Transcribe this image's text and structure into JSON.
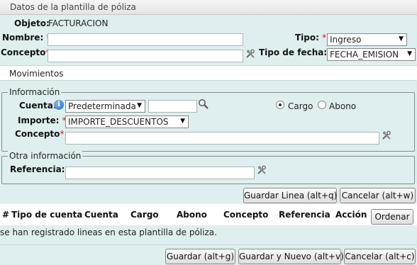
{
  "window": {
    "title": "Datos de la plantilla de póliza"
  },
  "header": {
    "objeto_label": "Objeto:",
    "objeto_value": "FACTURACION",
    "nombre_label": "Nombre:",
    "nombre_value": "",
    "concepto_label": "Concepto",
    "concepto_value": "",
    "tipo_label": "Tipo:",
    "tipo_value": "Ingreso",
    "tipo_fecha_label": "Tipo de fecha:",
    "tipo_fecha_value": "FECHA_EMISION",
    "required_mark": "*"
  },
  "tabs": {
    "movimientos": "Movimientos"
  },
  "informacion": {
    "legend": "Información",
    "cuenta_label": "Cuenta:",
    "cuenta_select": "Predeterminada",
    "cuenta_value": "",
    "cargo_label": "Cargo",
    "abono_label": "Abono",
    "cargo_selected": true,
    "importe_label": "Importe:",
    "importe_value": "IMPORTE_DESCUENTOS",
    "concepto_label": "Concepto",
    "concepto_value": ""
  },
  "otra_informacion": {
    "legend": "Otra información",
    "referencia_label": "Referencia:",
    "referencia_value": ""
  },
  "line_actions": {
    "save_line": "Guardar Linea (alt+q)",
    "cancel_line": "Cancelar (alt+w)"
  },
  "table": {
    "columns": [
      "#",
      "Tipo de cuenta",
      "Cuenta",
      "Cargo",
      "Abono",
      "Concepto",
      "Referencia",
      "Acción"
    ],
    "sort_button": "Ordenar",
    "empty_message": "se han registrado lineas en esta plantilla de póliza."
  },
  "footer": {
    "save": "Guardar (alt+g)",
    "save_new": "Guardar y Nuevo (alt+v)",
    "cancel": "Cancelar (alt+c)"
  },
  "icons": {
    "search": "magnifier-icon",
    "tools": "tools-icon",
    "info": "info-icon"
  }
}
